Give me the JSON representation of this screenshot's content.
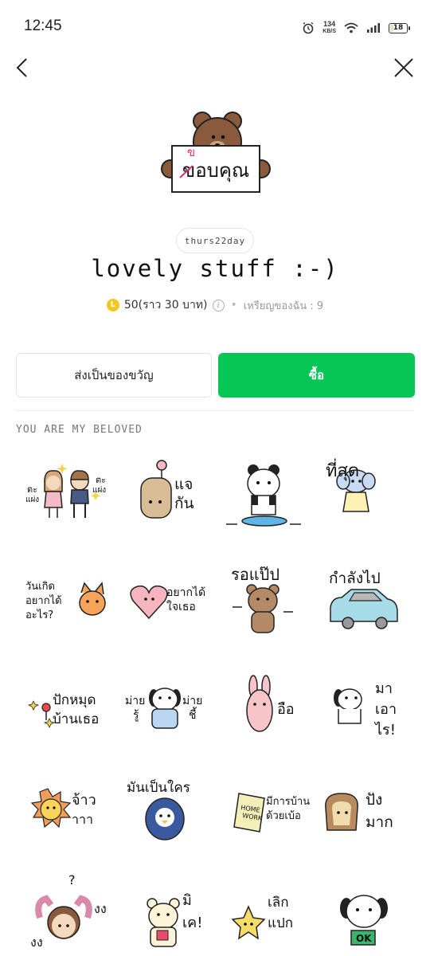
{
  "status_bar": {
    "time": "12:45",
    "net_speed_value": "134",
    "net_speed_unit": "KB/S",
    "battery_level": "18",
    "icons": [
      "alarm-icon",
      "wifi-icon",
      "signal-icon",
      "battery-icon"
    ]
  },
  "nav": {
    "back_icon": "chevron-left-icon",
    "close_icon": "close-icon"
  },
  "main_sticker": {
    "sign_text": "ขอบคุณ",
    "sign_correction": "ข"
  },
  "author": "thurs22day",
  "title": "lovely stuff :-)",
  "price": {
    "coin_symbol": "L",
    "amount_text": "50(ราว 30 บาท)",
    "info_symbol": "i",
    "my_coins_text": "เหรียญของฉัน : 9"
  },
  "buttons": {
    "gift_label": "ส่งเป็นของขวัญ",
    "buy_label": "ซื้อ"
  },
  "colors": {
    "accent_green": "#06c755",
    "coin_yellow": "#f6c623",
    "divider": "#eeeeee"
  },
  "section_label": "YOU ARE MY BELOVED",
  "stickers": [
    {
      "id": "couple",
      "lines": [
        "ตะ",
        "แผ่ง",
        "ตะ",
        "แผ่ง"
      ]
    },
    {
      "id": "flower-head",
      "lines": [
        "แจ",
        "กัน"
      ]
    },
    {
      "id": "panda-skate",
      "lines": []
    },
    {
      "id": "elephant-best",
      "lines": [
        "ที่สุด"
      ]
    },
    {
      "id": "cat-birthday",
      "lines": [
        "วันเกิด",
        "อยากได้",
        "อะไร?"
      ]
    },
    {
      "id": "heart-want",
      "lines": [
        "อยากได้",
        "ใจเธอ"
      ]
    },
    {
      "id": "bear-wait",
      "lines": [
        "รอแป๊ป"
      ]
    },
    {
      "id": "car-going",
      "lines": [
        "กำลังไป"
      ]
    },
    {
      "id": "pin-home",
      "lines": [
        "ปักหมุด",
        "บ้านเธอ"
      ]
    },
    {
      "id": "dog-dunno",
      "lines": [
        "ม่าย",
        "รู้",
        "ม่าย",
        "ชี้"
      ]
    },
    {
      "id": "rabbit-ok",
      "lines": [
        "อือ"
      ]
    },
    {
      "id": "dog-bring",
      "lines": [
        "มา",
        "เอา",
        "ไร!"
      ]
    },
    {
      "id": "sun-yes",
      "lines": [
        "จ้าว",
        "าาา"
      ]
    },
    {
      "id": "penguin-who",
      "lines": [
        "มันเป็นใคร"
      ]
    },
    {
      "id": "homework",
      "lines": [
        "HOME",
        "WORK",
        "มีการบ้าน",
        "ด้วยเบ้อ"
      ]
    },
    {
      "id": "bread-great",
      "lines": [
        "ปัง",
        "มาก"
      ]
    },
    {
      "id": "girl-confused",
      "lines": [
        "?",
        "งง",
        "งง"
      ]
    },
    {
      "id": "bear-no",
      "lines": [
        "มิ",
        "เค!"
      ]
    },
    {
      "id": "star-weird",
      "lines": [
        "เลิก",
        "แปก"
      ]
    },
    {
      "id": "dog-ok",
      "lines": [
        "OK"
      ]
    }
  ]
}
